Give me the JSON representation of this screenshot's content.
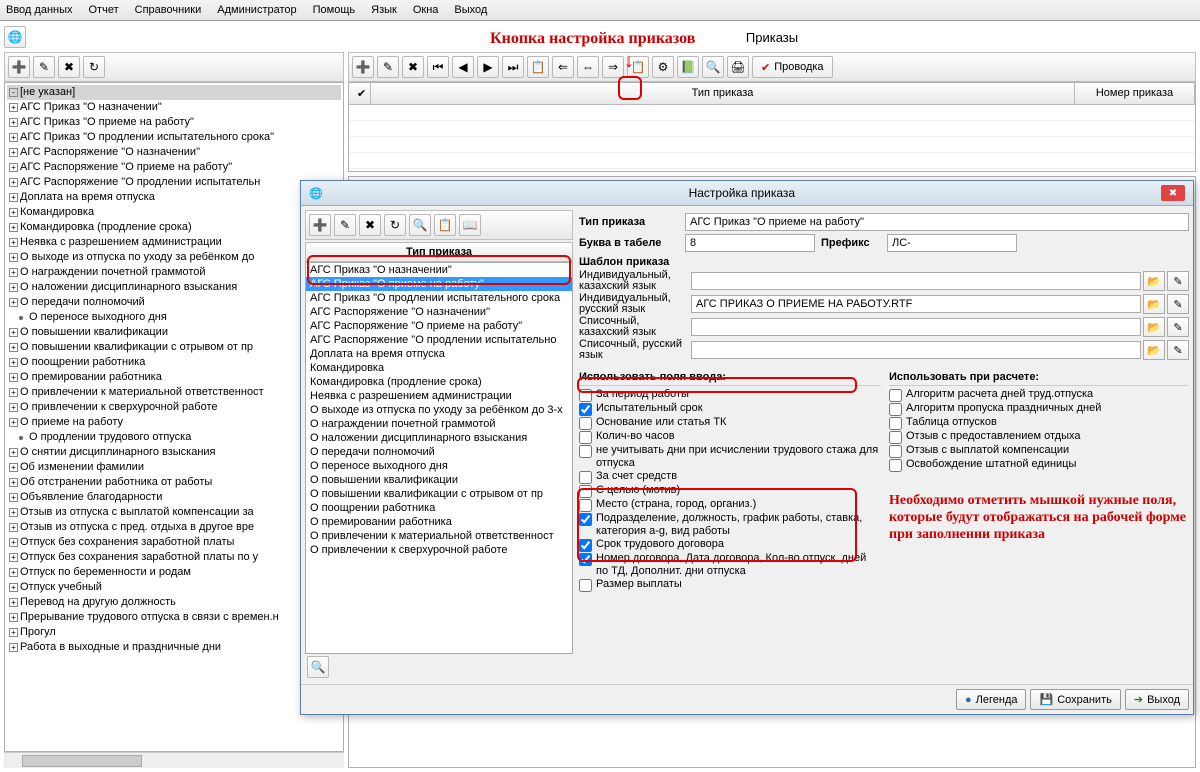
{
  "menu": [
    "Ввод данных",
    "Отчет",
    "Справочники",
    "Администратор",
    "Помощь",
    "Язык",
    "Окна",
    "Выход"
  ],
  "left_tool": [
    "➕",
    "✎",
    "✖",
    "↻"
  ],
  "right_title": "Приказы",
  "right_tool": [
    "➕",
    "✎",
    "✖",
    "⏮",
    "◀",
    "▶",
    "⏭",
    "📋",
    "⇐",
    "⇔",
    "⇒",
    "📋",
    "⚙",
    "📗",
    "🔍",
    "🖨"
  ],
  "provodka": "Проводка",
  "grid_cols": {
    "check": "✔",
    "type": "Тип приказа",
    "num": "Номер приказа"
  },
  "tree_root": "[не указан]",
  "tree": [
    "АГС Приказ \"О назначении\"",
    "АГС Приказ \"О приеме на работу\"",
    "АГС Приказ \"О продлении испытательного срока\"",
    "АГС Распоряжение \"О назначении\"",
    "АГС Распоряжение \"О приеме на работу\"",
    "АГС Распоряжение \"О продлении испытательн",
    "Доплата на время отпуска",
    "Командировка",
    "Командировка (продление срока)",
    "Неявка с разрешением администрации",
    "О выходе из отпуска по уходу за ребёнком до",
    "О награждении почетной граммотой",
    "О наложении дисциплинарного взыскания",
    "О передачи полномочий",
    "О переносе выходного дня",
    "О повышении квалификации",
    "О повышении квалификации с отрывом от пр",
    "О поощрении работника",
    "О премировании работника",
    "О привлечении к материальной ответственност",
    "О привлечении к сверхурочной работе",
    "О приеме на работу",
    "О продлении трудового отпуска",
    "О снятии дисциплинарного взыскания",
    "Об изменении фамилии",
    "Об отстранении работника от работы",
    "Объявление благодарности",
    "Отзыв из отпуска с выплатой компенсации за",
    "Отзыв из отпуска с пред. отдыха в другое вре",
    "Отпуск без сохранения заработной платы",
    "Отпуск без сохранения заработной платы по у",
    "Отпуск по беременности и родам",
    "Отпуск учебный",
    "Перевод на другую должность",
    "Прерывание трудового отпуска в связи с времен.н",
    "Прогул",
    "Работа в выходные и праздничные дни"
  ],
  "tree_leaf_only": [
    14,
    22
  ],
  "dlg": {
    "title": "Настройка приказа",
    "tool": [
      "➕",
      "✎",
      "✖",
      "↻",
      "🔍",
      "📋",
      "📖"
    ],
    "list_header": "Тип приказа",
    "list": [
      "АГС Приказ \"О назначении\"",
      "АГС Приказ \"О приеме на работу\"",
      "АГС Приказ \"О продлении испытательного срока",
      "АГС Распоряжение \"О назначении\"",
      "АГС Распоряжение \"О приеме на работу\"",
      "АГС Распоряжение \"О продлении испытательно",
      "Доплата на время отпуска",
      "Командировка",
      "Командировка (продление срока)",
      "Неявка с разрешением администрации",
      "О выходе из отпуска по уходу за ребёнком до 3-х",
      "О награждении почетной граммотой",
      "О наложении дисциплинарного взыскания",
      "О передачи полномочий",
      "О переносе выходного дня",
      "О повышении квалификации",
      "О повышении квалификации с отрывом от пр",
      "О поощрении работника",
      "О премировании работника",
      "О привлечении к материальной ответственност",
      "О привлечении к сверхурочной работе"
    ],
    "list_sel": 1,
    "lbl_type": "Тип приказа",
    "val_type": "АГС Приказ \"О приеме на работу\"",
    "lbl_letter": "Буква в табеле",
    "val_letter": "8",
    "lbl_prefix": "Префикс",
    "val_prefix": "ЛС-",
    "lbl_template": "Шаблон приказа",
    "paths": [
      {
        "lbl": "Индивидуальный, казахский язык",
        "val": ""
      },
      {
        "lbl": "Индивидуальный, русский язык",
        "val": "АГС ПРИКАЗ О ПРИЕМЕ НА РАБОТУ.RTF"
      },
      {
        "lbl": "Списочный, казахский язык",
        "val": ""
      },
      {
        "lbl": "Списочный, русский язык",
        "val": ""
      }
    ],
    "use_input": "Использовать поля ввода:",
    "use_calc": "Использовать при расчете:",
    "chk_input": [
      {
        "t": "За период работы",
        "c": false
      },
      {
        "t": "Испытательный срок",
        "c": true
      },
      {
        "t": "Основание или статья ТК",
        "c": false
      },
      {
        "t": "Колич-во часов",
        "c": false
      },
      {
        "t": "не учитывать дни при исчислении трудового стажа для отпуска",
        "c": false
      },
      {
        "t": "За счет средств",
        "c": false
      },
      {
        "t": "С целью (мотив)",
        "c": false
      },
      {
        "t": "Место (страна, город, организ.)",
        "c": false
      },
      {
        "t": "Подразделение, должность, график работы, ставка, категория a-g, вид работы",
        "c": true
      },
      {
        "t": "Срок трудового договора",
        "c": true
      },
      {
        "t": "Номер договора, Дата договора, Кол-во отпуск. дней по ТД, Дополнит. дни отпуска",
        "c": true
      },
      {
        "t": "Размер выплаты",
        "c": false
      }
    ],
    "chk_calc": [
      {
        "t": "Алгоритм расчета дней труд.отпуска",
        "c": false
      },
      {
        "t": "Алгоритм пропуска праздничных дней",
        "c": false
      },
      {
        "t": "Таблица отпусков",
        "c": false
      },
      {
        "t": "Отзыв с предоставлением отдыха",
        "c": false
      },
      {
        "t": "Отзыв с выплатой компенсации",
        "c": false
      },
      {
        "t": "Освобождение штатной единицы",
        "c": false
      }
    ],
    "btn_legend": "Легенда",
    "btn_save": "Сохранить",
    "btn_exit": "Выход"
  },
  "anno": {
    "top": "Кнопка настройка приказов",
    "right": "Необходимо отметить мышкой нужные поля, которые будут отображаться на рабочей форме при заполнении приказа"
  }
}
